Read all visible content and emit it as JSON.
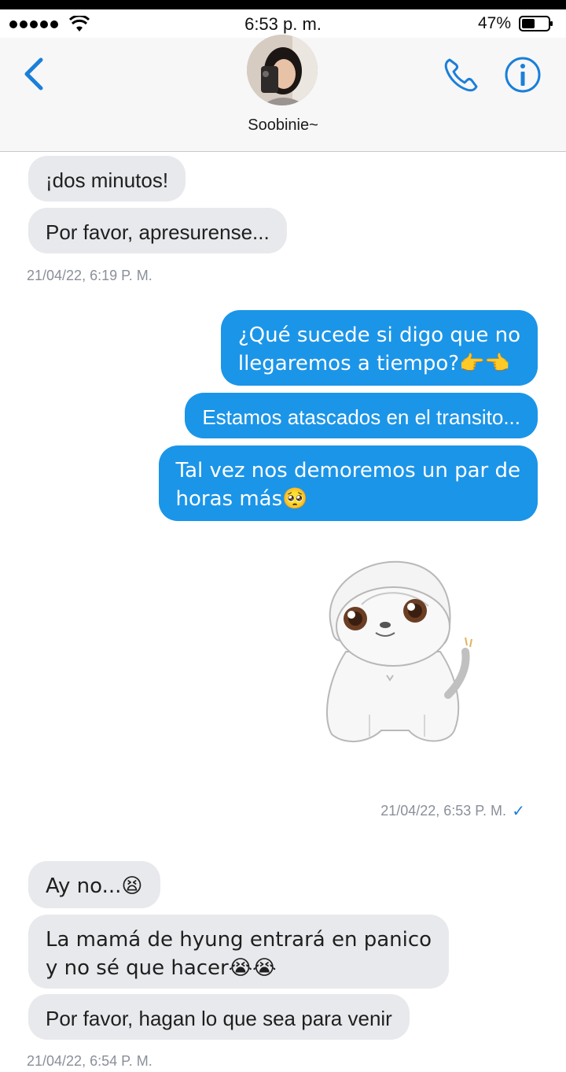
{
  "status_bar": {
    "time": "6:53 p. m.",
    "battery": "47%"
  },
  "header": {
    "contact_name": "Soobinie~",
    "icons": [
      "back-chevron-icon",
      "avatar",
      "phone-icon",
      "info-icon"
    ]
  },
  "messages": {
    "m1": "¡dos minutos!",
    "m2": "Por favor, apresurense...",
    "ts1": "21/04/22, 6:19 P. M.",
    "m3": "¿Qué sucede si digo que no\nllegaremos a tiempo?👉👈",
    "m4": "Estamos atascados en el transito...",
    "m5": "Tal vez nos demoremos un par de\nhoras más🥺",
    "sticker": "white-puppy-sticker",
    "ts2": "21/04/22, 6:53 P. M.",
    "ts2_check": "✓",
    "m6": "Ay no...😫",
    "m7": "La mamá de hyung entrará en panico\ny no sé que hacer😭😭",
    "m8": "Por favor, hagan lo que sea para venir",
    "ts3": "21/04/22, 6:54 P. M."
  },
  "colors": {
    "outgoing_bubble": "#1b95e8",
    "incoming_bubble": "#e8e9ec",
    "accent": "#1b7fd8",
    "timestamp": "#8a8f99"
  }
}
